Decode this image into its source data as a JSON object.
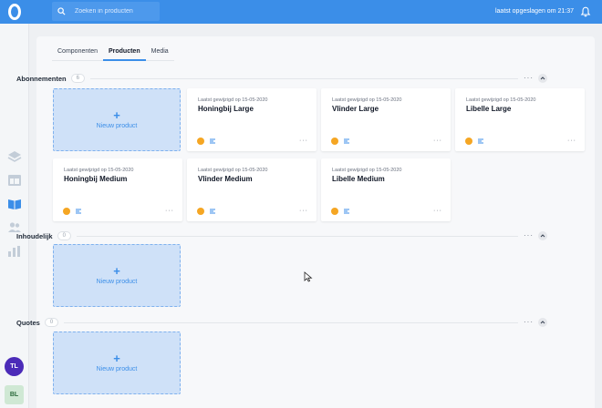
{
  "app": {
    "logo_icon": "brand-o-icon"
  },
  "topbar": {
    "search_placeholder": "Zoeken in producten",
    "saved_status": "laatst opgeslagen om 21:37"
  },
  "sidebar": {
    "items": [
      {
        "icon": "layers-icon"
      },
      {
        "icon": "layout-icon"
      },
      {
        "icon": "book-open-icon",
        "active": true
      },
      {
        "icon": "users-icon"
      },
      {
        "icon": "bar-chart-icon"
      }
    ],
    "avatars": [
      "TL",
      "BL"
    ]
  },
  "tabs": [
    {
      "label": "Componenten"
    },
    {
      "label": "Producten",
      "active": true
    },
    {
      "label": "Media"
    }
  ],
  "new_product_label": "Nieuw product",
  "more_label": "···",
  "sections": [
    {
      "title": "Abonnementen",
      "count": "6",
      "products": [
        {
          "edited": "Laatst gewijzigd op 15-05-2020",
          "name": "Honingbij Large"
        },
        {
          "edited": "Laatst gewijzigd op 15-05-2020",
          "name": "Vlinder Large"
        },
        {
          "edited": "Laatst gewijzigd op 15-05-2020",
          "name": "Libelle Large"
        },
        {
          "edited": "Laatst gewijzigd op 15-05-2020",
          "name": "Honingbij Medium"
        },
        {
          "edited": "Laatst gewijzigd op 15-05-2020",
          "name": "Vlinder Medium"
        },
        {
          "edited": "Laatst gewijzigd op 15-05-2020",
          "name": "Libelle Medium"
        }
      ]
    },
    {
      "title": "Inhoudelijk",
      "count": "0",
      "products": []
    },
    {
      "title": "Quotes",
      "count": "0",
      "products": []
    }
  ],
  "colors": {
    "brand": "#3b8ee8",
    "new_card_bg": "#cfe1f8",
    "avatar_tl": "#4b2bb8"
  }
}
